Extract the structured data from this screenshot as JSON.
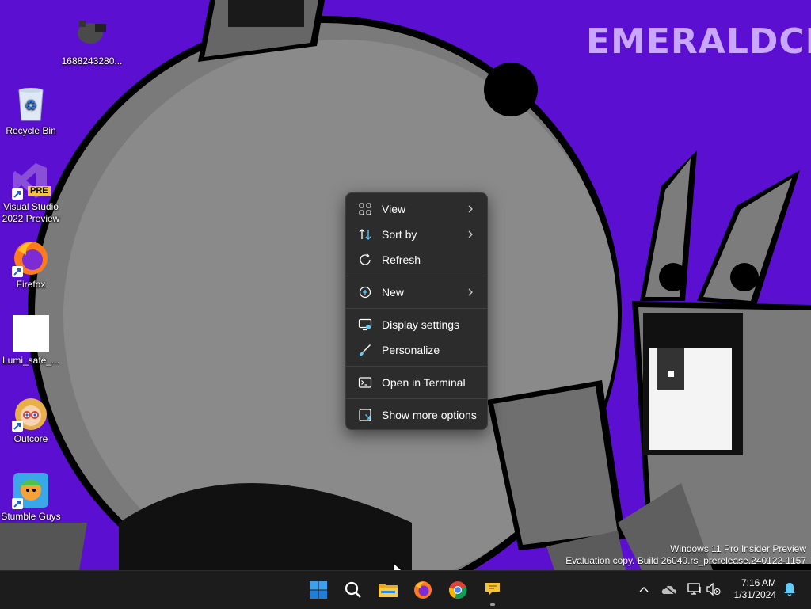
{
  "desktop": {
    "icons": [
      {
        "label": "1688243280...",
        "icon": "image-file-icon"
      },
      {
        "label": "Recycle Bin",
        "icon": "recycle-bin-icon"
      },
      {
        "label": "Visual Studio 2022 Preview",
        "icon": "visual-studio-icon",
        "badge": "PRE"
      },
      {
        "label": "Firefox",
        "icon": "firefox-icon"
      },
      {
        "label": "Lumi_safe_...",
        "icon": "blank-file-icon"
      },
      {
        "label": "Outcore",
        "icon": "outcore-game-icon"
      },
      {
        "label": "Stumble Guys",
        "icon": "stumble-guys-icon"
      }
    ],
    "wallpaper_text": "EMERALDCRAFTS",
    "watermark": {
      "line1": "Windows 11 Pro Insider Preview",
      "line2": "Evaluation copy. Build 26040.rs_prerelease.240122-1157"
    }
  },
  "context_menu": {
    "items": [
      {
        "label": "View",
        "icon": "view-grid-icon",
        "submenu": true
      },
      {
        "label": "Sort by",
        "icon": "sort-icon",
        "submenu": true
      },
      {
        "label": "Refresh",
        "icon": "refresh-icon",
        "submenu": false
      },
      {
        "label": "New",
        "icon": "new-plus-icon",
        "submenu": true
      },
      {
        "label": "Display settings",
        "icon": "display-settings-icon",
        "submenu": false
      },
      {
        "label": "Personalize",
        "icon": "personalize-brush-icon",
        "submenu": false
      },
      {
        "label": "Open in Terminal",
        "icon": "terminal-icon",
        "submenu": false
      },
      {
        "label": "Show more options",
        "icon": "more-options-icon",
        "submenu": false
      }
    ]
  },
  "taskbar": {
    "apps": [
      "start-icon",
      "search-icon",
      "file-explorer-icon",
      "firefox-icon",
      "chrome-icon",
      "feedback-hub-icon"
    ],
    "tray": [
      "chevron-up-icon",
      "onedrive-icon",
      "network-icon",
      "volume-muted-icon",
      "notification-bell-icon"
    ],
    "time": "7:16 AM",
    "date": "1/31/2024"
  },
  "colors": {
    "wallpaper_purple": "#5b0fd1",
    "menu_bg": "#2c2c2c",
    "taskbar_bg": "#1c1c1c",
    "accent": "#60cdff"
  }
}
